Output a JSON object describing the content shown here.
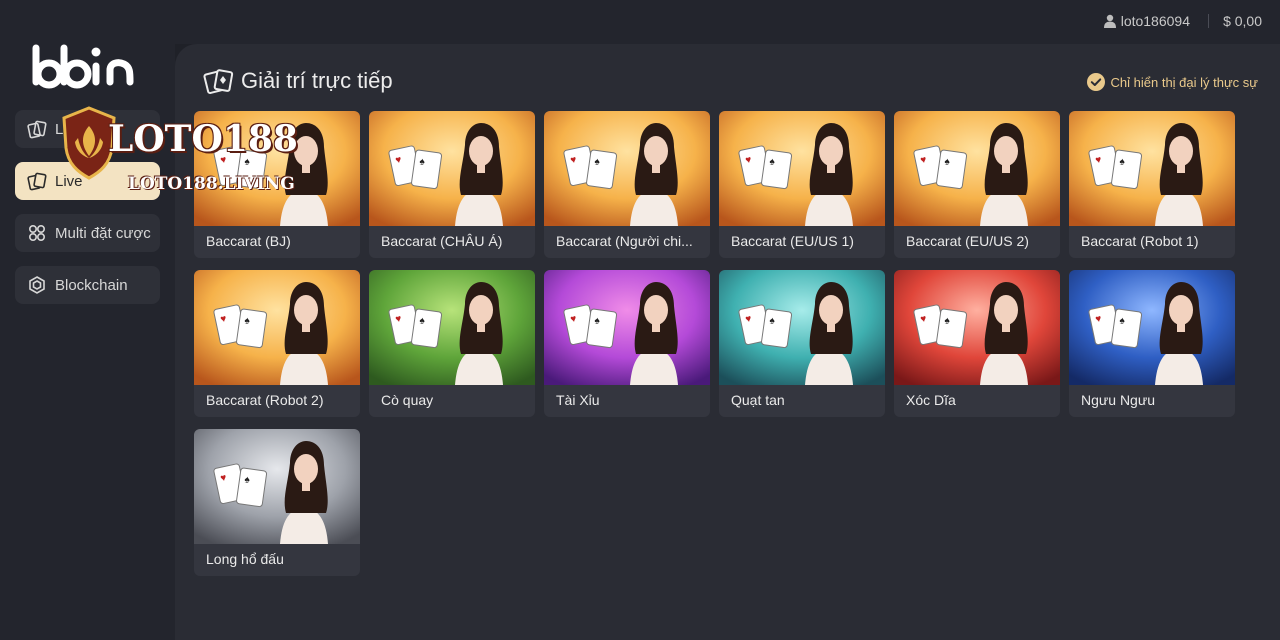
{
  "header": {
    "username": "loto186094",
    "balance": "$ 0,00",
    "user_icon": "user-icon"
  },
  "sidebar": {
    "logo_text": "bbin",
    "items": [
      {
        "label": "Live",
        "icon": "cards-icon",
        "active": false
      },
      {
        "label": "Live",
        "icon": "cards-icon",
        "active": true
      },
      {
        "label": "Multi đặt cược",
        "icon": "multi-bet-icon",
        "active": false
      },
      {
        "label": "Blockchain",
        "icon": "blockchain-icon",
        "active": false
      }
    ]
  },
  "watermark": {
    "big": "LOTO188",
    "small": "LOTO188.LIVING"
  },
  "main": {
    "title": "Giải trí trực tiếp",
    "filter_label": "Chỉ hiển thị đại lý thực sự",
    "games": [
      {
        "label": "Baccarat (BJ)",
        "theme": "gold"
      },
      {
        "label": "Baccarat (CHÂU Á)",
        "theme": "gold"
      },
      {
        "label": "Baccarat (Người chi...",
        "theme": "gold"
      },
      {
        "label": "Baccarat (EU/US 1)",
        "theme": "gold"
      },
      {
        "label": "Baccarat (EU/US 2)",
        "theme": "gold"
      },
      {
        "label": "Baccarat (Robot 1)",
        "theme": "gold"
      },
      {
        "label": "Baccarat (Robot 2)",
        "theme": "gold"
      },
      {
        "label": "Cò quay",
        "theme": "green"
      },
      {
        "label": "Tài Xỉu",
        "theme": "purple"
      },
      {
        "label": "Quạt tan",
        "theme": "teal"
      },
      {
        "label": "Xóc Dĩa",
        "theme": "red"
      },
      {
        "label": "Ngưu Ngưu",
        "theme": "blue"
      },
      {
        "label": "Long hổ đấu",
        "theme": "silver"
      }
    ]
  },
  "colors": {
    "accent": "#e9c98b",
    "active_nav": "#f3e3c2",
    "background": "#1f2128",
    "panel": "#2a2c34"
  }
}
